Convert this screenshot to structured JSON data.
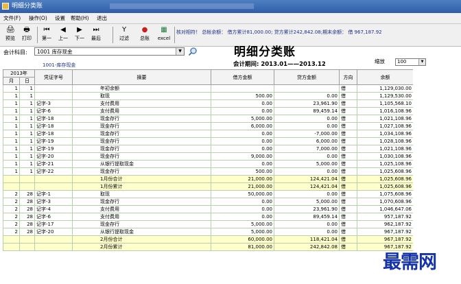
{
  "window": {
    "title": "明细分类账",
    "title_blur": ""
  },
  "menu": [
    "文件(F)",
    "操作(O)",
    "设置",
    "帮助(H)",
    "退出"
  ],
  "toolbar": [
    {
      "icon": "🖨",
      "label": "预览"
    },
    {
      "icon": "🖶",
      "label": "打印"
    },
    {
      "icon": "⏮",
      "label": "第一"
    },
    {
      "icon": "◀",
      "label": "上一"
    },
    {
      "icon": "▶",
      "label": "下一"
    },
    {
      "icon": "⏭",
      "label": "最后"
    },
    {
      "icon": "Y",
      "label": "过滤"
    },
    {
      "icon": "●",
      "label": "总账"
    },
    {
      "icon": "▦",
      "label": "excel"
    }
  ],
  "notice": "核对相符！ 总帐余额： 借方累计81,000.00; 贷方累计242,842.08;期末余额： 借 967,187.92",
  "account": {
    "label": "会计科目:",
    "value": "1001  库存现金",
    "sub": "1001-库存现金"
  },
  "report": {
    "title": "明细分类账",
    "period": "会计期间: 2013.01——2013.12"
  },
  "zoom": {
    "label": "缩放",
    "value": "100"
  },
  "table": {
    "year_header": "2013年",
    "month_header": "月",
    "day_header": "日",
    "headers": [
      "凭证字号",
      "摘要",
      "借方金额",
      "贷方金额",
      "方向",
      "余额"
    ],
    "rows": [
      {
        "m": "1",
        "d": "1",
        "voucher": "",
        "summary": "年初余额",
        "debit": "",
        "credit": "",
        "dir": "借",
        "balance": "1,129,030.00",
        "yellow": false
      },
      {
        "m": "1",
        "d": "1",
        "voucher": "",
        "summary": "取现",
        "debit": "500.00",
        "credit": "0.00",
        "dir": "借",
        "balance": "1,129,530.00",
        "yellow": false
      },
      {
        "m": "1",
        "d": "1",
        "voucher": "记字-3",
        "summary": "支付费用",
        "debit": "0.00",
        "credit": "23,961.90",
        "dir": "借",
        "balance": "1,105,568.10",
        "yellow": false
      },
      {
        "m": "1",
        "d": "1",
        "voucher": "记字-6",
        "summary": "支付费用",
        "debit": "0.00",
        "credit": "89,459.14",
        "dir": "借",
        "balance": "1,016,108.96",
        "yellow": false
      },
      {
        "m": "1",
        "d": "1",
        "voucher": "记字-18",
        "summary": "现金存行",
        "debit": "5,000.00",
        "credit": "0.00",
        "dir": "借",
        "balance": "1,021,108.96",
        "yellow": false
      },
      {
        "m": "1",
        "d": "1",
        "voucher": "记字-18",
        "summary": "现金存行",
        "debit": "6,000.00",
        "credit": "0.00",
        "dir": "借",
        "balance": "1,027,108.96",
        "yellow": false
      },
      {
        "m": "1",
        "d": "1",
        "voucher": "记字-18",
        "summary": "现金存行",
        "debit": "0.00",
        "credit": "-7,000.00",
        "dir": "借",
        "balance": "1,034,108.96",
        "yellow": false
      },
      {
        "m": "1",
        "d": "1",
        "voucher": "记字-19",
        "summary": "现金存行",
        "debit": "0.00",
        "credit": "6,000.00",
        "dir": "借",
        "balance": "1,028,108.96",
        "yellow": false
      },
      {
        "m": "1",
        "d": "1",
        "voucher": "记字-19",
        "summary": "现金存行",
        "debit": "0.00",
        "credit": "7,000.00",
        "dir": "借",
        "balance": "1,021,108.96",
        "yellow": false
      },
      {
        "m": "1",
        "d": "1",
        "voucher": "记字-20",
        "summary": "现金存行",
        "debit": "9,000.00",
        "credit": "0.00",
        "dir": "借",
        "balance": "1,030,108.96",
        "yellow": false
      },
      {
        "m": "1",
        "d": "1",
        "voucher": "记字-21",
        "summary": "从银行提取现金",
        "debit": "0.00",
        "credit": "5,000.00",
        "dir": "借",
        "balance": "1,025,108.96",
        "yellow": false
      },
      {
        "m": "1",
        "d": "1",
        "voucher": "记字-22",
        "summary": "现金存行",
        "debit": "500.00",
        "credit": "0.00",
        "dir": "借",
        "balance": "1,025,608.96",
        "yellow": false
      },
      {
        "m": "",
        "d": "",
        "voucher": "",
        "summary": "1月份合计",
        "debit": "21,000.00",
        "credit": "124,421.04",
        "dir": "借",
        "balance": "1,025,608.96",
        "yellow": true
      },
      {
        "m": "",
        "d": "",
        "voucher": "",
        "summary": "1月份累计",
        "debit": "21,000.00",
        "credit": "124,421.04",
        "dir": "借",
        "balance": "1,025,608.96",
        "yellow": true
      },
      {
        "m": "2",
        "d": "28",
        "voucher": "记字-1",
        "summary": "取现",
        "debit": "50,000.00",
        "credit": "0.00",
        "dir": "借",
        "balance": "1,075,608.96",
        "yellow": false
      },
      {
        "m": "2",
        "d": "28",
        "voucher": "记字-3",
        "summary": "现金存行",
        "debit": "0.00",
        "credit": "5,000.00",
        "dir": "借",
        "balance": "1,070,608.96",
        "yellow": false
      },
      {
        "m": "2",
        "d": "28",
        "voucher": "记字-4",
        "summary": "支付费用",
        "debit": "0.00",
        "credit": "23,961.90",
        "dir": "借",
        "balance": "1,046,647.06",
        "yellow": false
      },
      {
        "m": "2",
        "d": "28",
        "voucher": "记字-6",
        "summary": "支付费用",
        "debit": "0.00",
        "credit": "89,459.14",
        "dir": "借",
        "balance": "957,187.92",
        "yellow": false
      },
      {
        "m": "2",
        "d": "28",
        "voucher": "记字-17",
        "summary": "现金存行",
        "debit": "5,000.00",
        "credit": "0.00",
        "dir": "借",
        "balance": "962,187.92",
        "yellow": false
      },
      {
        "m": "2",
        "d": "28",
        "voucher": "记字-20",
        "summary": "从银行提取现金",
        "debit": "5,000.00",
        "credit": "0.00",
        "dir": "借",
        "balance": "967,187.92",
        "yellow": false
      },
      {
        "m": "",
        "d": "",
        "voucher": "",
        "summary": "2月份合计",
        "debit": "60,000.00",
        "credit": "118,421.04",
        "dir": "借",
        "balance": "967,187.92",
        "yellow": true
      },
      {
        "m": "",
        "d": "",
        "voucher": "",
        "summary": "2月份累计",
        "debit": "81,000.00",
        "credit": "242,842.08",
        "dir": "借",
        "balance": "967,187.92",
        "yellow": true
      }
    ]
  },
  "watermark": "最需网"
}
